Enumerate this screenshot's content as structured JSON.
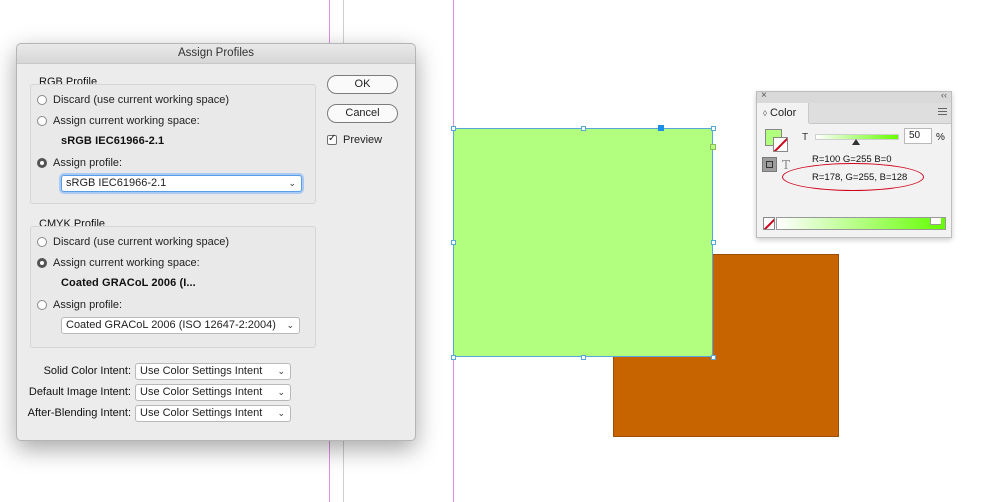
{
  "dialog": {
    "title": "Assign Profiles",
    "ok_label": "OK",
    "cancel_label": "Cancel",
    "preview_label": "Preview",
    "preview_checked": true,
    "rgb": {
      "group_title": "RGB Profile",
      "discard_label": "Discard (use current working space)",
      "assign_current_label": "Assign current working space:",
      "current_space": "sRGB IEC61966-2.1",
      "assign_profile_label": "Assign profile:",
      "profile_value": "sRGB IEC61966-2.1",
      "selected": "assign_profile"
    },
    "cmyk": {
      "group_title": "CMYK Profile",
      "discard_label": "Discard (use current working space)",
      "assign_current_label": "Assign current working space:",
      "current_space": "Coated GRACoL 2006 (I...",
      "assign_profile_label": "Assign profile:",
      "profile_value": "Coated GRACoL 2006 (ISO 12647-2:2004)",
      "selected": "assign_current"
    },
    "intents": {
      "solid_label": "Solid Color Intent:",
      "solid_value": "Use Color Settings Intent",
      "image_label": "Default Image Intent:",
      "image_value": "Use Color Settings Intent",
      "blending_label": "After-Blending Intent:",
      "blending_value": "Use Color Settings Intent"
    }
  },
  "color_panel": {
    "close_glyph": "×",
    "collapse_glyph": "‹‹",
    "tab_label": "Color",
    "tab_arrows": "◊",
    "tint_letter": "T",
    "tint_value": "50",
    "tint_unit": "%",
    "text_letter": "T",
    "values_line1": "R=100 G=255 B=0",
    "values_line2": "R=178, G=255, B=128"
  },
  "colors": {
    "green_fill": "#b2ff80",
    "brown_fill": "#c86400",
    "annotation": "#d0021b",
    "guide_magenta": "#e07ae6"
  }
}
